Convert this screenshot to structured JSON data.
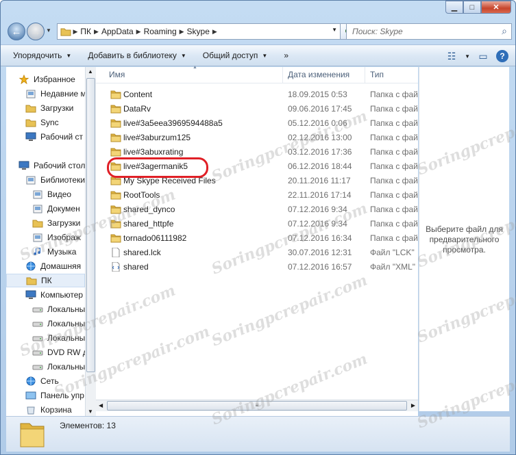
{
  "nav": {
    "breadcrumb": [
      "ПК",
      "AppData",
      "Roaming",
      "Skype"
    ]
  },
  "search": {
    "placeholder": "Поиск: Skype"
  },
  "toolbar": {
    "organize": "Упорядочить",
    "add_library": "Добавить в библиотеку",
    "share": "Общий доступ",
    "more": "»"
  },
  "columns": {
    "name": "Имя",
    "date": "Дата изменения",
    "type": "Тип"
  },
  "sidebar": {
    "items": [
      {
        "label": "Избранное",
        "icon": "star-icon"
      },
      {
        "label": "Недавние м",
        "icon": "recent-places-icon"
      },
      {
        "label": "Загрузки",
        "icon": "downloads-folder-icon"
      },
      {
        "label": "Sync",
        "icon": "folder-icon"
      },
      {
        "label": "Рабочий ст",
        "icon": "desktop-icon"
      },
      {
        "label": "Рабочий стол",
        "icon": "desktop-icon"
      },
      {
        "label": "Библиотеки",
        "icon": "libraries-icon"
      },
      {
        "label": "Видео",
        "icon": "video-library-icon"
      },
      {
        "label": "Докумен",
        "icon": "documents-library-icon"
      },
      {
        "label": "Загрузки",
        "icon": "downloads-folder-icon"
      },
      {
        "label": "Изображ",
        "icon": "pictures-library-icon"
      },
      {
        "label": "Музыка",
        "icon": "music-library-icon"
      },
      {
        "label": "Домашняя",
        "icon": "homegroup-icon"
      },
      {
        "label": "ПК",
        "icon": "folder-icon"
      },
      {
        "label": "Компьютер",
        "icon": "computer-icon"
      },
      {
        "label": "Локальны",
        "icon": "drive-icon"
      },
      {
        "label": "Локальны",
        "icon": "drive-icon"
      },
      {
        "label": "Локальны",
        "icon": "drive-icon"
      },
      {
        "label": "DVD RW д",
        "icon": "dvd-drive-icon"
      },
      {
        "label": "Локальны",
        "icon": "drive-icon"
      },
      {
        "label": "Сеть",
        "icon": "network-icon"
      },
      {
        "label": "Панель упр",
        "icon": "control-panel-icon"
      },
      {
        "label": "Корзина",
        "icon": "recycle-bin-icon"
      }
    ]
  },
  "files": [
    {
      "name": "Content",
      "date": "18.09.2015 0:53",
      "type": "Папка с файлами",
      "icon": "folder-icon"
    },
    {
      "name": "DataRv",
      "date": "09.06.2016 17:45",
      "type": "Папка с файлами",
      "icon": "folder-icon"
    },
    {
      "name": "live#3a5eea3969594488a5",
      "date": "05.12.2016 0:06",
      "type": "Папка с файлами",
      "icon": "folder-icon"
    },
    {
      "name": "live#3aburzum125",
      "date": "02.12.2016 13:00",
      "type": "Папка с файлами",
      "icon": "folder-icon"
    },
    {
      "name": "live#3abuxrating",
      "date": "03.12.2016 17:36",
      "type": "Папка с файлами",
      "icon": "folder-icon"
    },
    {
      "name": "live#3agermanik5",
      "date": "06.12.2016 18:44",
      "type": "Папка с файлами",
      "icon": "folder-icon"
    },
    {
      "name": "My Skype Received Files",
      "date": "20.11.2016 11:17",
      "type": "Папка с файлами",
      "icon": "folder-icon"
    },
    {
      "name": "RootTools",
      "date": "22.11.2016 17:14",
      "type": "Папка с файлами",
      "icon": "folder-icon"
    },
    {
      "name": "shared_dynco",
      "date": "07.12.2016 9:34",
      "type": "Папка с файлами",
      "icon": "folder-icon"
    },
    {
      "name": "shared_httpfe",
      "date": "07.12.2016 9:34",
      "type": "Папка с файлами",
      "icon": "folder-icon"
    },
    {
      "name": "tornado06111982",
      "date": "07.12.2016 16:34",
      "type": "Папка с файлами",
      "icon": "folder-icon"
    },
    {
      "name": "shared.lck",
      "date": "30.07.2016 12:31",
      "type": "Файл \"LCK\"",
      "icon": "file-icon"
    },
    {
      "name": "shared",
      "date": "07.12.2016 16:57",
      "type": "Файл \"XML\"",
      "icon": "xml-file-icon"
    }
  ],
  "preview": {
    "message": "Выберите файл для предварительного просмотра."
  },
  "status": {
    "items_count": "Элементов: 13"
  },
  "watermark": "Soringpcrepair.com",
  "colors": {
    "folder": "#e8c255",
    "highlight": "#e01f26"
  }
}
